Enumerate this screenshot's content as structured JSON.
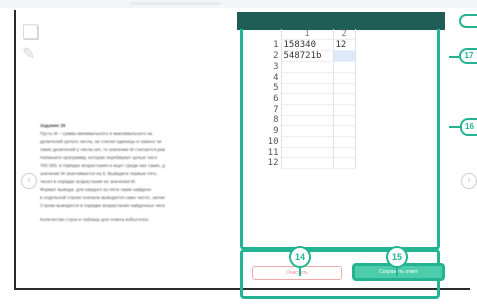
{
  "panel": {
    "header_cols": [
      "1",
      "2"
    ],
    "rows": [
      {
        "n": "1",
        "a": "158340",
        "b": "12"
      },
      {
        "n": "2",
        "a": "548721b",
        "b": ""
      },
      {
        "n": "3",
        "a": "",
        "b": ""
      },
      {
        "n": "4",
        "a": "",
        "b": ""
      },
      {
        "n": "5",
        "a": "",
        "b": ""
      },
      {
        "n": "6",
        "a": "",
        "b": ""
      },
      {
        "n": "7",
        "a": "",
        "b": ""
      },
      {
        "n": "8",
        "a": "",
        "b": ""
      },
      {
        "n": "9",
        "a": "",
        "b": ""
      },
      {
        "n": "10",
        "a": "",
        "b": ""
      },
      {
        "n": "11",
        "a": "",
        "b": ""
      },
      {
        "n": "12",
        "a": "",
        "b": ""
      }
    ],
    "clear_label": "Очистить",
    "save_label": "Сохранить ответ"
  },
  "callouts": {
    "table": "16",
    "header": "17",
    "clear": "14",
    "save": "15"
  },
  "task": {
    "title": "Задание 25",
    "lines": [
      "Пусть  М  –  сумма  минимального  и  максимального  на",
      "делителей целого числа, не считая единицы и самого чи",
      "таких делителей у числа нет, то значение М считается рав",
      "Напишите  программу,  которая  перебирает  целые  числ",
      "700 000, в порядке возрастания и ищет среди них такие, д",
      "значение  М  оканчивается на 8. Выведите первые пять",
      "чисел в порядке возрастания их значения М.",
      "Формат  вывода:  для  каждого  из  пяти  таких  найденн",
      "в отдельной строке сначала выводится само число, затем",
      "Строки выводятся в порядке возрастания найденных чисе"
    ],
    "footer": "Количество строк в таблице для ответа избыточно."
  },
  "colors": {
    "accent": "#25b493",
    "header": "#1e5e56",
    "save": "#4ccca9",
    "clear": "#ef8f8f"
  }
}
